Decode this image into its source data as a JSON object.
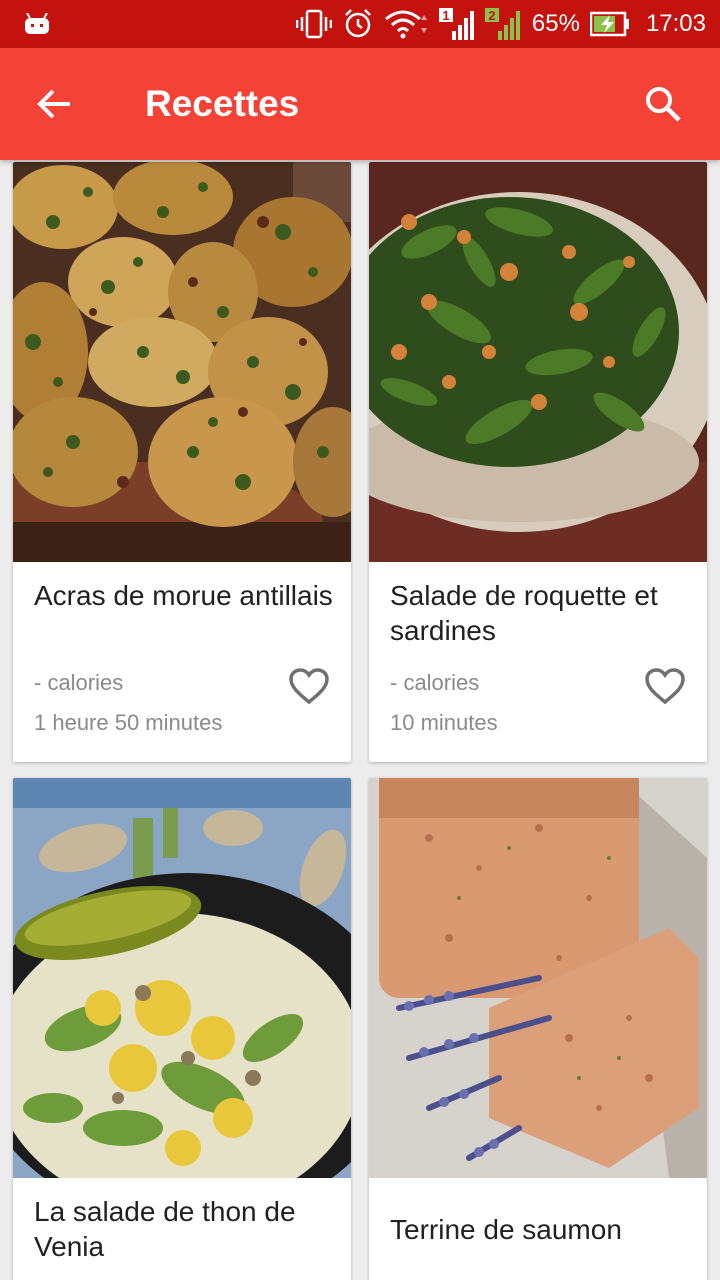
{
  "status_bar": {
    "battery_percent": "65%",
    "time": "17:03",
    "sim1_label": "1",
    "sim2_label": "2",
    "icons": [
      "android-icon",
      "vibrate-icon",
      "alarm-icon",
      "wifi-icon",
      "signal-sim1-icon",
      "signal-sim2-icon",
      "battery-charging-icon"
    ],
    "color": "#c4120e"
  },
  "app_bar": {
    "title": "Recettes",
    "color": "#f44336",
    "back_icon": "arrow-back-icon",
    "search_icon": "search-icon"
  },
  "recipes": [
    {
      "title": "Acras de morue antillais",
      "calories": "- calories",
      "duration": "1 heure 50 minutes",
      "image": "fritters-photo"
    },
    {
      "title": "Salade de roquette et sardines",
      "calories": "- calories",
      "duration": "10 minutes",
      "image": "arugula-salad-photo"
    },
    {
      "title": "La salade de thon de Venia",
      "calories": "",
      "duration": "",
      "image": "tuna-salad-photo"
    },
    {
      "title": "Terrine de saumon",
      "calories": "",
      "duration": "",
      "image": "salmon-terrine-photo"
    }
  ]
}
